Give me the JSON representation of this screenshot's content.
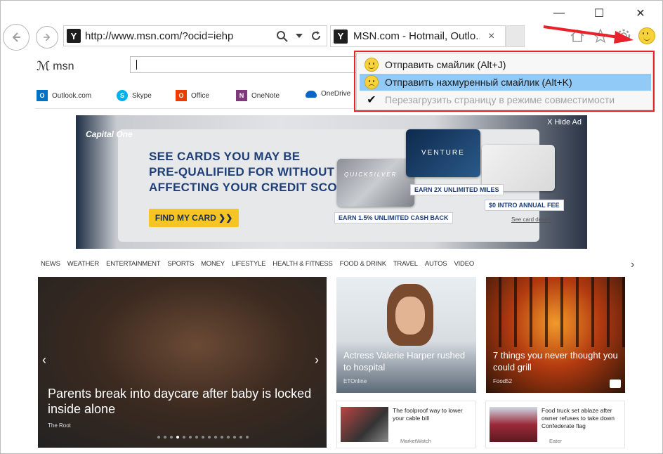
{
  "browser": {
    "address": "http://www.msn.com/?ocid=iehp",
    "tab_title": "MSN.com - Hotmail, Outlo...",
    "tab_close": "×",
    "window": {
      "minimize": "—",
      "maximize": "☐",
      "close": "✕"
    }
  },
  "page": {
    "logo_text": "msn",
    "quicklinks": [
      {
        "label": "Outlook.com",
        "icon": "outlook-icon",
        "color": "#0072c6"
      },
      {
        "label": "Skype",
        "icon": "skype-icon",
        "color": "#00aff0"
      },
      {
        "label": "Office",
        "icon": "office-icon",
        "color": "#eb3c00"
      },
      {
        "label": "OneNote",
        "icon": "onenote-icon",
        "color": "#80397b"
      },
      {
        "label": "OneDrive",
        "icon": "onedrive-icon",
        "color": "#0a64c8"
      }
    ],
    "ad": {
      "brand": "Capital One",
      "hide": "X Hide Ad",
      "headline1": "SEE CARDS YOU MAY BE",
      "headline2": "PRE-QUALIFIED FOR WITHOUT",
      "headline3": "AFFECTING YOUR CREDIT SCORE.",
      "cta": "FIND MY CARD  ❯❯",
      "card_venture": "VENTURE",
      "card_quicksilver": "QUICKSILVER",
      "offer1": "EARN 2X UNLIMITED MILES",
      "offer2": "EARN 1.5% UNLIMITED CASH BACK",
      "offer3": "$0 INTRO ANNUAL FEE",
      "details": "See card details"
    },
    "nav": [
      "NEWS",
      "WEATHER",
      "ENTERTAINMENT",
      "SPORTS",
      "MONEY",
      "LIFESTYLE",
      "HEALTH & FITNESS",
      "FOOD & DRINK",
      "TRAVEL",
      "AUTOS",
      "VIDEO"
    ],
    "hero": {
      "caption": "Parents break into daycare after baby is locked inside alone",
      "source": "The Root"
    },
    "tile2": {
      "caption": "Actress Valerie Harper rushed to hospital",
      "source": "ETOnline"
    },
    "tile3": {
      "caption": "7 things you never thought you could grill",
      "source": "Food52"
    },
    "small1": {
      "title": "The foolproof way to lower your cable bill",
      "source": "MarketWatch"
    },
    "small2": {
      "title": "Food truck set ablaze after owner refuses to take down Confederate flag",
      "source": "Eater"
    }
  },
  "menu": {
    "item1": "Отправить смайлик (Alt+J)",
    "item2": "Отправить нахмуренный смайлик (Alt+K)",
    "item3": "Перезагрузить страницу в режиме совместимости",
    "check": "✔"
  },
  "colors": {
    "highlight": "#91c9f7",
    "annotation": "#e8212b",
    "ad_text": "#1f3f78",
    "cta": "#f5c623"
  }
}
